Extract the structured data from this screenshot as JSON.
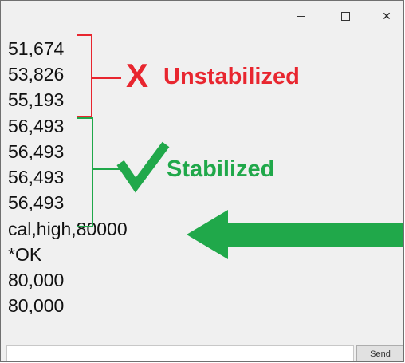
{
  "window": {
    "controls": {
      "minimize_icon": "minimize-icon",
      "maximize_icon": "maximize-icon",
      "close_icon": "close-icon",
      "close_glyph": "✕"
    }
  },
  "output_lines": [
    "51,674",
    "53,826",
    "55,193",
    "56,493",
    "56,493",
    "56,493",
    "56,493",
    "cal,high,80000",
    "*OK",
    "80,000",
    "80,000"
  ],
  "annotations": {
    "unstabilized": {
      "mark": "X",
      "label": "Unstabilized",
      "color": "#e8262f"
    },
    "stabilized": {
      "mark": "check-icon",
      "label": "Stabilized",
      "color": "#20a84a"
    },
    "arrow": {
      "icon": "left-arrow-icon",
      "color": "#20a84a"
    }
  },
  "input": {
    "value": "",
    "placeholder": ""
  },
  "send_button": {
    "label": "Send"
  }
}
